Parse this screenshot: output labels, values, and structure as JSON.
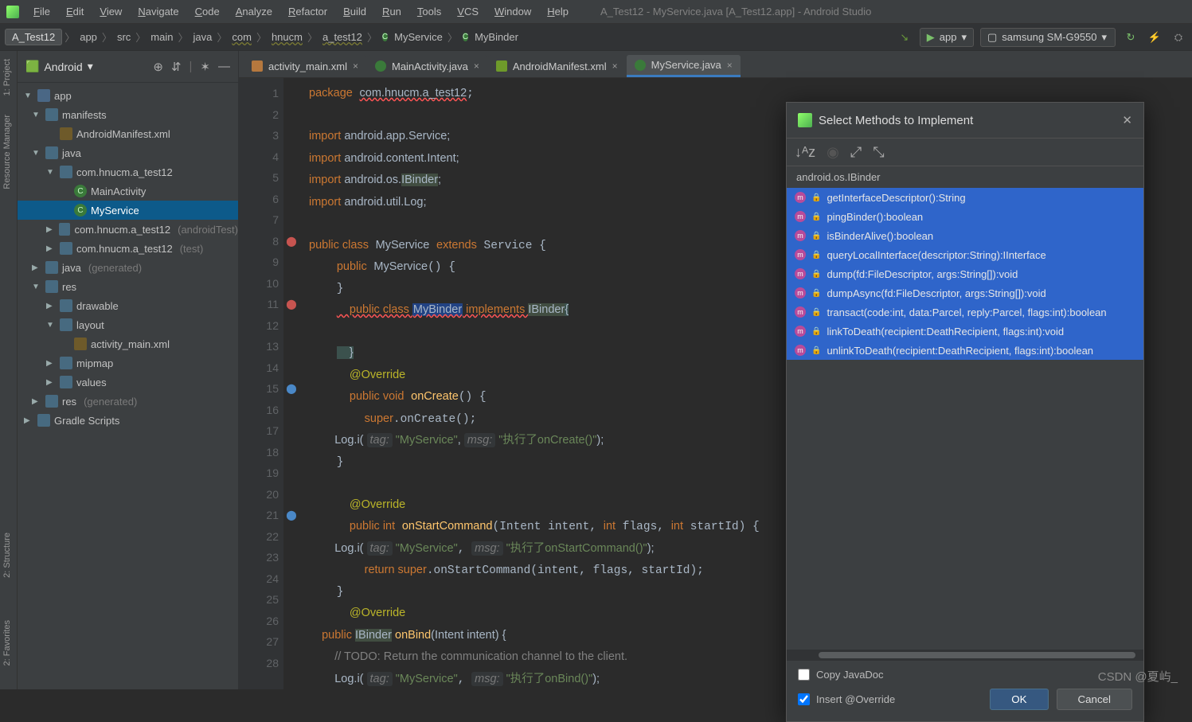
{
  "window_title": "A_Test12 - MyService.java [A_Test12.app] - Android Studio",
  "menus": [
    "File",
    "Edit",
    "View",
    "Navigate",
    "Code",
    "Analyze",
    "Refactor",
    "Build",
    "Run",
    "Tools",
    "VCS",
    "Window",
    "Help"
  ],
  "breadcrumbs": [
    "A_Test12",
    "app",
    "src",
    "main",
    "java",
    "com",
    "hnucm",
    "a_test12"
  ],
  "breadcrumb_class": "MyService",
  "breadcrumb_inner": "MyBinder",
  "run_config": "app",
  "device": "samsung SM-G9550",
  "vtabs": [
    "1: Project",
    "Resource Manager",
    "2: Structure",
    "2: Favorites"
  ],
  "project": {
    "view": "Android",
    "tree": [
      {
        "d": 0,
        "ar": "▼",
        "ic": "mod",
        "label": "app"
      },
      {
        "d": 1,
        "ar": "▼",
        "ic": "dir",
        "label": "manifests"
      },
      {
        "d": 2,
        "ar": "",
        "ic": "xml",
        "label": "AndroidManifest.xml"
      },
      {
        "d": 1,
        "ar": "▼",
        "ic": "dir",
        "label": "java"
      },
      {
        "d": 2,
        "ar": "▼",
        "ic": "pkg",
        "label": "com.hnucm.a_test12"
      },
      {
        "d": 3,
        "ar": "",
        "ic": "cls",
        "label": "MainActivity"
      },
      {
        "d": 3,
        "ar": "",
        "ic": "cls",
        "label": "MyService",
        "sel": true
      },
      {
        "d": 2,
        "ar": "▶",
        "ic": "pkg",
        "label": "com.hnucm.a_test12",
        "dim": "(androidTest)"
      },
      {
        "d": 2,
        "ar": "▶",
        "ic": "pkg",
        "label": "com.hnucm.a_test12",
        "dim": "(test)"
      },
      {
        "d": 1,
        "ar": "▶",
        "ic": "dir",
        "label": "java",
        "dim": "(generated)"
      },
      {
        "d": 1,
        "ar": "▼",
        "ic": "dir",
        "label": "res"
      },
      {
        "d": 2,
        "ar": "▶",
        "ic": "dir",
        "label": "drawable"
      },
      {
        "d": 2,
        "ar": "▼",
        "ic": "dir",
        "label": "layout"
      },
      {
        "d": 3,
        "ar": "",
        "ic": "xml",
        "label": "activity_main.xml"
      },
      {
        "d": 2,
        "ar": "▶",
        "ic": "dir",
        "label": "mipmap"
      },
      {
        "d": 2,
        "ar": "▶",
        "ic": "dir",
        "label": "values"
      },
      {
        "d": 1,
        "ar": "▶",
        "ic": "dir",
        "label": "res",
        "dim": "(generated)"
      },
      {
        "d": 0,
        "ar": "▶",
        "ic": "dir",
        "label": "Gradle Scripts"
      }
    ]
  },
  "tabs": [
    {
      "label": "activity_main.xml",
      "ic": "xml"
    },
    {
      "label": "MainActivity.java",
      "ic": "java"
    },
    {
      "label": "AndroidManifest.xml",
      "ic": "mf"
    },
    {
      "label": "MyService.java",
      "ic": "java",
      "active": true
    }
  ],
  "code_lines": [
    1,
    2,
    3,
    4,
    5,
    6,
    7,
    8,
    9,
    10,
    11,
    12,
    13,
    14,
    15,
    16,
    17,
    18,
    19,
    20,
    21,
    22,
    23,
    24,
    25,
    26,
    27,
    28
  ],
  "code": {
    "l1": "package com.hnucm.a_test12;",
    "l3a": "import",
    "l3b": " android.app.Service;",
    "l4a": "import",
    "l4b": " android.content.Intent;",
    "l5a": "import",
    "l5b": " android.os.",
    "l5c": "IBinder",
    "l5d": ";",
    "l6a": "import",
    "l6b": " android.util.Log;",
    "l8": "public class MyService extends Service {",
    "l9": "    public MyService() {",
    "l10": "    }",
    "l11a": "    public class ",
    "l11b": "MyBinder",
    "l11c": " implements ",
    "l11d": "IBinder",
    "l11e": "{",
    "l13": "    }",
    "l14": "    @Override",
    "l15": "    public void onCreate() {",
    "l16": "        super.onCreate();",
    "l17a": "        Log.i( ",
    "l17t": "tag:",
    "l17s1": " \"MyService\"",
    "l17c": ", ",
    "l17m": "msg:",
    "l17s2": " \"执行了onCreate()\"",
    "l17e": ");",
    "l18": "    }",
    "l20": "    @Override",
    "l21": "    public int onStartCommand(Intent intent, int flags, int startId) {",
    "l22a": "        Log.i( ",
    "l22s1": " \"MyService\"",
    "l22s2": " \"执行了onStartCommand()\"",
    "l22e": ");",
    "l23": "        return super.onStartCommand(intent, flags, startId);",
    "l24": "    }",
    "l25": "    @Override",
    "l26a": "    public ",
    "l26b": "IBinder",
    "l26c": " onBind(Intent intent) {",
    "l27": "        // TODO: Return the communication channel to the client.",
    "l28a": "        Log.i( ",
    "l28s1": " \"MyService\"",
    "l28s2": " \"执行了onBind()\"",
    "l28e": ");"
  },
  "dialog": {
    "title": "Select Methods to Implement",
    "crumb": "android.os.IBinder",
    "items": [
      "getInterfaceDescriptor():String",
      "pingBinder():boolean",
      "isBinderAlive():boolean",
      "queryLocalInterface(descriptor:String):IInterface",
      "dump(fd:FileDescriptor, args:String[]):void",
      "dumpAsync(fd:FileDescriptor, args:String[]):void",
      "transact(code:int, data:Parcel, reply:Parcel, flags:int):boolean",
      "linkToDeath(recipient:DeathRecipient, flags:int):void",
      "unlinkToDeath(recipient:DeathRecipient, flags:int):boolean"
    ],
    "copy_javadoc": "Copy JavaDoc",
    "insert_override": "Insert @Override",
    "ok": "OK",
    "cancel": "Cancel"
  },
  "watermark": "CSDN @夏屿_"
}
